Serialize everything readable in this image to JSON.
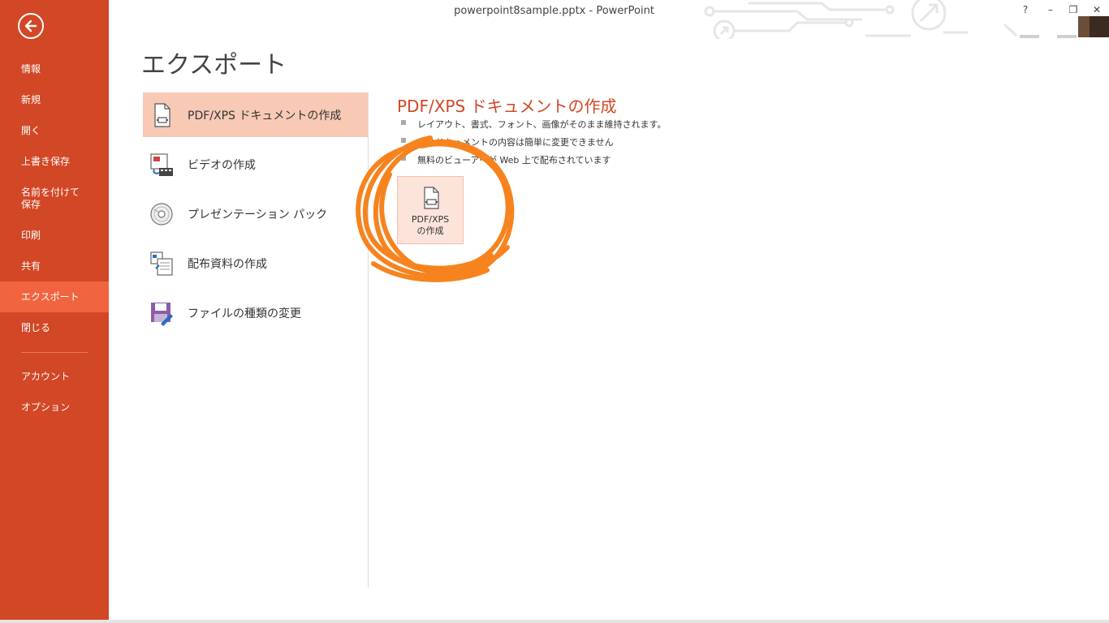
{
  "window": {
    "title": "powerpoint8sample.pptx - PowerPoint",
    "help_label": "?",
    "minimize_label": "–",
    "restore_label": "❐",
    "close_label": "✕"
  },
  "sidebar": {
    "accent_color": "#D24726",
    "active_color": "#F0653F",
    "items": [
      {
        "label": "情報"
      },
      {
        "label": "新規"
      },
      {
        "label": "開く"
      },
      {
        "label": "上書き保存"
      },
      {
        "label": "名前を付けて\n保存"
      },
      {
        "label": "印刷"
      },
      {
        "label": "共有"
      },
      {
        "label": "エクスポート",
        "active": true
      },
      {
        "label": "閉じる"
      },
      {
        "label": "アカウント"
      },
      {
        "label": "オプション"
      }
    ]
  },
  "page": {
    "title": "エクスポート"
  },
  "export_options": [
    {
      "label": "PDF/XPS ドキュメントの作成",
      "icon": "pdf-document-icon",
      "active": true
    },
    {
      "label": "ビデオの作成",
      "icon": "video-icon"
    },
    {
      "label": "プレゼンテーション パック",
      "icon": "cd-disc-icon"
    },
    {
      "label": "配布資料の作成",
      "icon": "handouts-icon"
    },
    {
      "label": "ファイルの種類の変更",
      "icon": "save-as-type-icon"
    }
  ],
  "detail": {
    "title": "PDF/XPS ドキュメントの作成",
    "bullets": [
      "レイアウト、書式、フォント、画像がそのまま維持されます。",
      "このドキュメントの内容は簡単に変更できません",
      "無料のビューアーが Web 上で配布されています"
    ],
    "create_button": {
      "label_line1": "PDF/XPS",
      "label_line2": "の作成",
      "icon": "pdf-document-icon"
    },
    "annotation_color": "#F7831E"
  }
}
